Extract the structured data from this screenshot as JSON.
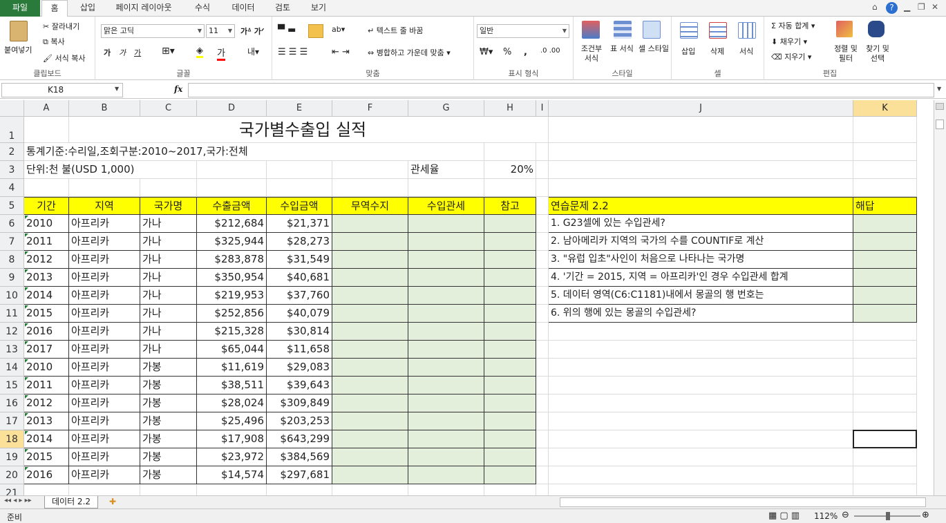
{
  "ribbon_tabs": [
    "파일",
    "홈",
    "삽입",
    "페이지 레이아웃",
    "수식",
    "데이터",
    "검토",
    "보기"
  ],
  "ribbon": {
    "clipboard": {
      "label": "클립보드",
      "paste": "붙여넣기",
      "cut": "잘라내기",
      "copy": "복사",
      "format_painter": "서식 복사"
    },
    "font": {
      "label": "글꼴",
      "font_name": "맑은 고딕",
      "font_size": "11",
      "bold": "가",
      "italic": "가",
      "underline": "가"
    },
    "align": {
      "label": "맞춤",
      "wrap": "텍스트 줄 바꿈",
      "merge": "병합하고 가운데 맞춤"
    },
    "number": {
      "label": "표시 형식",
      "format": "일반",
      "percent": "%",
      "comma": ","
    },
    "styles": {
      "label": "스타일",
      "cond": "조건부 서식",
      "table": "표 서식",
      "cell": "셀 스타일"
    },
    "cells": {
      "label": "셀",
      "insert": "삽입",
      "delete": "삭제",
      "format": "서식"
    },
    "edit": {
      "label": "편집",
      "autosum": "자동 합계",
      "fill": "채우기",
      "clear": "지우기",
      "sort": "정렬 및 필터",
      "find": "찾기 및 선택"
    }
  },
  "name_box": "K18",
  "fx": "fx",
  "columns": [
    "A",
    "B",
    "C",
    "D",
    "E",
    "F",
    "G",
    "H",
    "I",
    "J",
    "K"
  ],
  "title": "국가별수출입 실적",
  "row2": "통계기준:수리일,조회구분:2010~2017,국가:전체",
  "row3": "단위:천 불(USD 1,000)",
  "tariff_label": "관세율",
  "tariff_value": "20%",
  "headers": [
    "기간",
    "지역",
    "국가명",
    "수출금액",
    "수입금액",
    "무역수지",
    "수입관세",
    "참고"
  ],
  "rows": [
    [
      "2010",
      "아프리카",
      "가나",
      "$212,684",
      "$21,371"
    ],
    [
      "2011",
      "아프리카",
      "가나",
      "$325,944",
      "$28,273"
    ],
    [
      "2012",
      "아프리카",
      "가나",
      "$283,878",
      "$31,549"
    ],
    [
      "2013",
      "아프리카",
      "가나",
      "$350,954",
      "$40,681"
    ],
    [
      "2014",
      "아프리카",
      "가나",
      "$219,953",
      "$37,760"
    ],
    [
      "2015",
      "아프리카",
      "가나",
      "$252,856",
      "$40,079"
    ],
    [
      "2016",
      "아프리카",
      "가나",
      "$215,328",
      "$30,814"
    ],
    [
      "2017",
      "아프리카",
      "가나",
      "$65,044",
      "$11,658"
    ],
    [
      "2010",
      "아프리카",
      "가봉",
      "$11,619",
      "$29,083"
    ],
    [
      "2011",
      "아프리카",
      "가봉",
      "$38,511",
      "$39,643"
    ],
    [
      "2012",
      "아프리카",
      "가봉",
      "$28,024",
      "$309,849"
    ],
    [
      "2013",
      "아프리카",
      "가봉",
      "$25,496",
      "$203,253"
    ],
    [
      "2014",
      "아프리카",
      "가봉",
      "$17,908",
      "$643,299"
    ],
    [
      "2015",
      "아프리카",
      "가봉",
      "$23,972",
      "$384,569"
    ],
    [
      "2016",
      "아프리카",
      "가봉",
      "$14,574",
      "$297,681"
    ]
  ],
  "practice_title": "연습문제 2.2",
  "answer_header": "해답",
  "questions": [
    "1. G23셀에 있는 수입관세?",
    "2. 남아메리카 지역의 국가의 수를 COUNTIF로 계산",
    "3. \"유럽 입초\"사인이 처음으로 나타나는 국가명",
    "4. '기간 = 2015, 지역 = 아프리카'인 경우 수입관세 합계",
    "5. 데이터 영역(C6:C1181)내에서 몽골의 행 번호는",
    "6. 위의 행에 있는 몽골의 수입관세?"
  ],
  "sheet_tab": "데이터 2.2",
  "status": "준비",
  "zoom": "112%"
}
